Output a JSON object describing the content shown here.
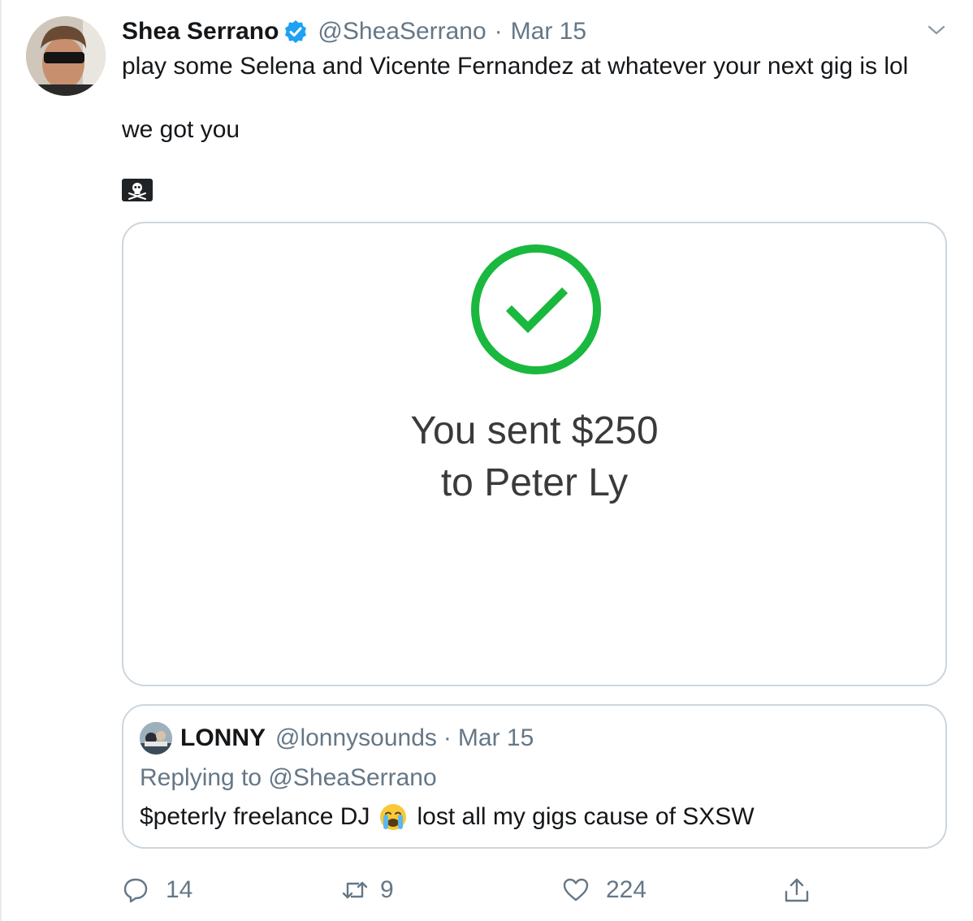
{
  "tweet": {
    "author_name": "Shea Serrano",
    "handle": "@SheaSerrano",
    "separator": "·",
    "date": "Mar 15",
    "text_line1": "play some Selena and Vicente Fernandez at whatever your next gig is lol",
    "text_line2": "we got you",
    "icons": [
      "verified-badge-icon",
      "chevron-down-icon",
      "skull-crossbones-emoji"
    ]
  },
  "media_card": {
    "line1": "You sent $250",
    "line2": "to Peter Ly",
    "accent_color": "#1ab83e"
  },
  "quote": {
    "author_name": "LONNY",
    "handle": "@lonnysounds",
    "separator": "·",
    "date": "Mar 15",
    "replying_to": "Replying to @SheaSerrano",
    "text_before_emoji": "$peterly freelance DJ",
    "text_after_emoji": "lost all my gigs cause of SXSW",
    "emoji": "crying-face-emoji"
  },
  "actions": {
    "replies": "14",
    "retweets": "9",
    "likes": "224",
    "icons": [
      "reply-icon",
      "retweet-icon",
      "like-icon",
      "share-icon"
    ]
  },
  "colors": {
    "text_primary": "#14171a",
    "text_secondary": "#657786",
    "border": "#ccd6dd",
    "verified_blue": "#1da1f2"
  }
}
